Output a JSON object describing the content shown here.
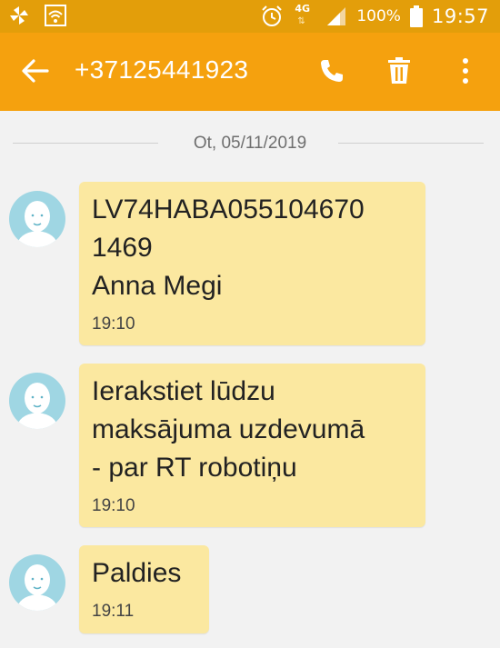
{
  "status_bar": {
    "network": "4G",
    "battery": "100%",
    "time": "19:57",
    "icons": [
      "pinwheel-icon",
      "wifi-icon",
      "alarm-icon",
      "signal-icon",
      "battery-icon"
    ]
  },
  "header": {
    "contact": "+37125441923",
    "colors": {
      "status_bar": "#e39e0a",
      "app_bar": "#f5a10e",
      "bubble": "#fbe8a0",
      "avatar": "#9fd6e3"
    }
  },
  "conversation": {
    "date": "Ot, 05/11/2019",
    "messages": [
      {
        "text": "LV74HABA055104670\n1469\nAnna Megi",
        "time": "19:10"
      },
      {
        "text": "Ierakstiet lūdzu\nmaksājuma uzdevumā\n- par RT robotiņu",
        "time": "19:10"
      },
      {
        "text": "Paldies",
        "time": "19:11"
      }
    ]
  }
}
